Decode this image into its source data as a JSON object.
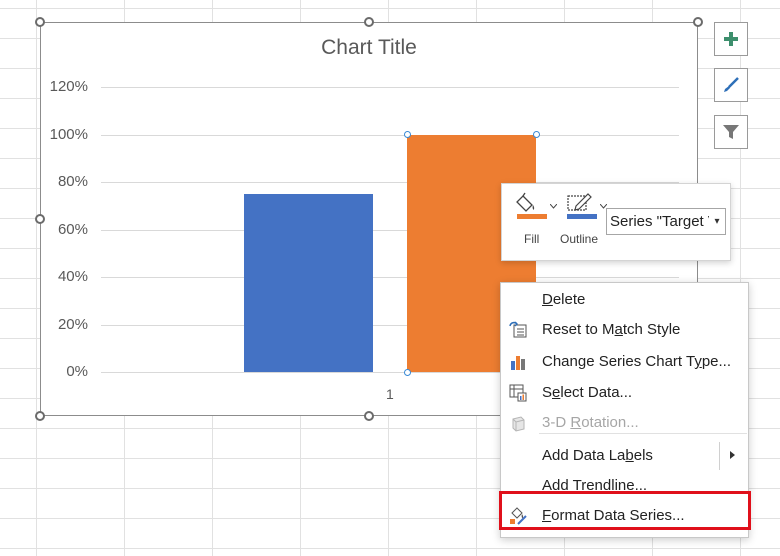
{
  "colors": {
    "series_blue": "#4472C4",
    "series_orange": "#ED7D31",
    "highlight_red": "#E0101B",
    "text_gray": "#595959"
  },
  "chart_data": {
    "type": "bar",
    "title": "Chart Title",
    "categories": [
      "1"
    ],
    "series": [
      {
        "values": [
          0.75
        ],
        "color": "#4472C4"
      },
      {
        "values": [
          1.0
        ],
        "color": "#ED7D31"
      }
    ],
    "ylim": [
      0,
      1.2
    ],
    "y_ticks": [
      "0%",
      "20%",
      "40%",
      "60%",
      "80%",
      "100%",
      "120%"
    ],
    "grid": true
  },
  "side_buttons": [
    {
      "icon": "plus-icon"
    },
    {
      "icon": "brush-icon"
    },
    {
      "icon": "filter-icon"
    }
  ],
  "mini_toolbar": {
    "fill_label": "Fill",
    "outline_label": "Outline",
    "series_selector_value": "Series \"Target V"
  },
  "context_menu": {
    "items": [
      {
        "pre": "",
        "ul": "D",
        "post": "elete",
        "icon": ""
      },
      {
        "pre": "Reset to M",
        "ul": "a",
        "post": "tch Style",
        "icon": "reset-style-icon"
      },
      {
        "pre": "Change Series Chart T",
        "ul": "y",
        "post": "pe...",
        "icon": "bar-chart-icon"
      },
      {
        "pre": "S",
        "ul": "e",
        "post": "lect Data...",
        "icon": "select-data-icon"
      },
      {
        "pre": "3-D ",
        "ul": "R",
        "post": "otation...",
        "icon": "cube-icon",
        "disabled": true
      },
      {
        "pre": "Add Data La",
        "ul": "b",
        "post": "els",
        "icon": "",
        "submenu": true
      },
      {
        "pre": "Add T",
        "ul": "r",
        "post": "endline...",
        "icon": ""
      },
      {
        "pre": "",
        "ul": "F",
        "post": "ormat Data Series...",
        "icon": "format-series-icon"
      }
    ]
  }
}
